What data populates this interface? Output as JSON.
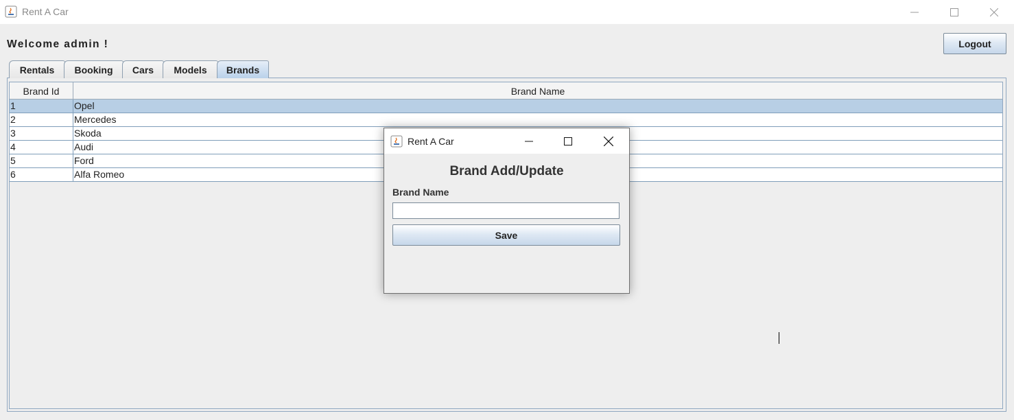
{
  "window": {
    "title": "Rent A Car"
  },
  "header": {
    "welcome": "Welcome admin !",
    "logout_label": "Logout"
  },
  "tabs": [
    {
      "label": "Rentals"
    },
    {
      "label": "Booking"
    },
    {
      "label": "Cars"
    },
    {
      "label": "Models"
    },
    {
      "label": "Brands",
      "active": true
    }
  ],
  "table": {
    "columns": [
      "Brand Id",
      "Brand Name"
    ],
    "selected_row": 0,
    "rows": [
      {
        "id": "1",
        "name": "Opel"
      },
      {
        "id": "2",
        "name": "Mercedes"
      },
      {
        "id": "3",
        "name": "Skoda"
      },
      {
        "id": "4",
        "name": "Audi"
      },
      {
        "id": "5",
        "name": "Ford"
      },
      {
        "id": "6",
        "name": "Alfa Romeo"
      }
    ]
  },
  "dialog": {
    "title": "Rent A Car",
    "heading": "Brand Add/Update",
    "field_label": "Brand Name",
    "field_value": "",
    "save_label": "Save"
  },
  "colors": {
    "selection": "#b8cfe5",
    "active_tab": "#b9d1ea",
    "border": "#8fa7c0"
  }
}
